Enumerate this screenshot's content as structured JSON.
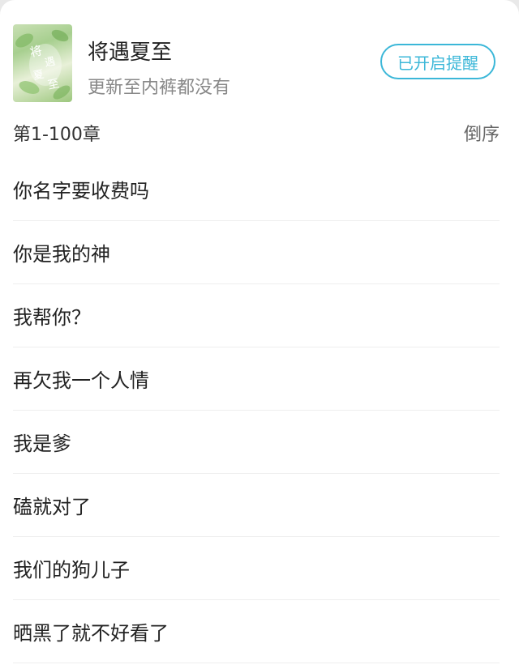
{
  "book": {
    "title": "将遇夏至",
    "update_status": "更新至内裤都没有",
    "cover_text": "将遇夏至",
    "cover_icon": "book-cover-image"
  },
  "remind_button": {
    "label": "已开启提醒",
    "color": "#3bb7d8"
  },
  "chapters_header": {
    "range": "第1-100章",
    "sort_label": "倒序"
  },
  "chapters": [
    {
      "title": "你名字要收费吗"
    },
    {
      "title": "你是我的神"
    },
    {
      "title": "我帮你？"
    },
    {
      "title": "再欠我一个人情"
    },
    {
      "title": "我是爹"
    },
    {
      "title": "磕就对了"
    },
    {
      "title": "我们的狗儿子"
    },
    {
      "title": "晒黑了就不好看了"
    }
  ]
}
